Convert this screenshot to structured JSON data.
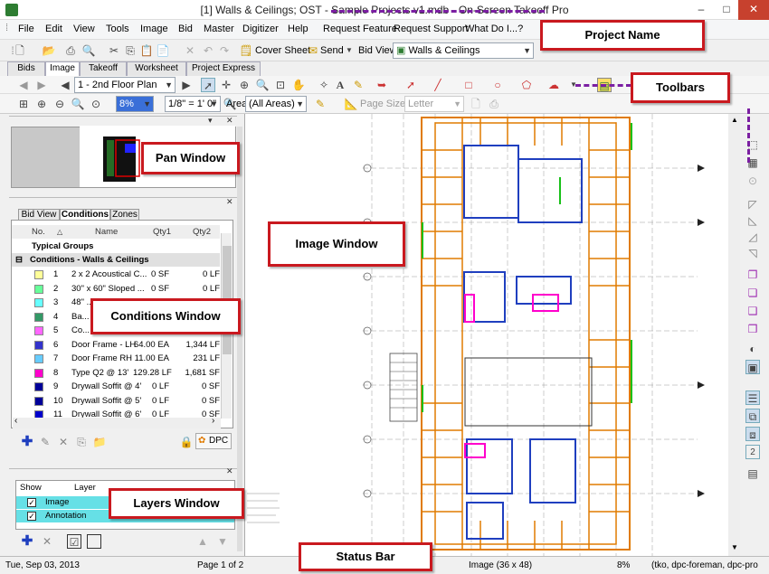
{
  "window": {
    "title": "[1] Walls & Ceilings; OST - Sample Projects v1.mdb - On-Screen Takeoff Pro",
    "minimize": "–",
    "maximize": "□",
    "close": "✕"
  },
  "menu": [
    "File",
    "Edit",
    "View",
    "Tools",
    "Image",
    "Bid",
    "Master",
    "Digitizer",
    "Help",
    "Request Feature",
    "Request Support",
    "What Do I...?"
  ],
  "toolbar": {
    "cover_sheet": "Cover Sheet",
    "send": "Send",
    "bid_view_label": "Bid View",
    "bid_view_value": "Walls & Ceilings"
  },
  "tabs": [
    "Bids",
    "Image",
    "Takeoff",
    "Worksheet",
    "Project Express"
  ],
  "image_toolbar": {
    "page": "1 - 2nd Floor Plan"
  },
  "zoom_toolbar": {
    "zoom": "8%",
    "scale": "1/8\" = 1' 0\"",
    "area_label": "Area",
    "area_value": "(All Areas)",
    "page_size_label": "Page Size",
    "page_size_value": "Letter"
  },
  "conditions": {
    "tabs": [
      "Bid View",
      "Conditions",
      "Zones"
    ],
    "headers": [
      "No.",
      "Name",
      "Qty1",
      "Qty2"
    ],
    "group": "Typical Groups",
    "subgroup": "Conditions - Walls & Ceilings",
    "rows": [
      {
        "no": "1",
        "name": "2 x 2 Acoustical C...",
        "qty1": "0 SF",
        "qty2": "0 LF",
        "color": "#ffff99"
      },
      {
        "no": "2",
        "name": "30\" x 60\" Sloped ...",
        "qty1": "0 SF",
        "qty2": "0 LF",
        "color": "#66ff99"
      },
      {
        "no": "3",
        "name": "48\" ...",
        "qty1": "",
        "qty2": "",
        "color": "#66ffff"
      },
      {
        "no": "4",
        "name": "Ba...",
        "qty1": "",
        "qty2": "",
        "color": "#339966"
      },
      {
        "no": "5",
        "name": "Co...",
        "qty1": "",
        "qty2": "",
        "color": "#ff66ff"
      },
      {
        "no": "6",
        "name": "Door Frame - LH",
        "qty1": "64.00 EA",
        "qty2": "1,344 LF",
        "color": "#3333cc"
      },
      {
        "no": "7",
        "name": "Door Frame RH",
        "qty1": "11.00 EA",
        "qty2": "231 LF",
        "color": "#66ccff"
      },
      {
        "no": "8",
        "name": "Type Q2 @ 13'",
        "qty1": "129.28 LF",
        "qty2": "1,681 SF",
        "color": "#ff00cc"
      },
      {
        "no": "9",
        "name": "Drywall Soffit @ 4'",
        "qty1": "0 LF",
        "qty2": "0 SF",
        "color": "#000099"
      },
      {
        "no": "10",
        "name": "Drywall Soffit @ 5'",
        "qty1": "0 LF",
        "qty2": "0 SF",
        "color": "#000099"
      },
      {
        "no": "11",
        "name": "Drywall Soffit @ 6'",
        "qty1": "0 LF",
        "qty2": "0 SF",
        "color": "#0000cc"
      }
    ],
    "dpc": "DPC"
  },
  "layers": {
    "headers": [
      "Show",
      "Layer"
    ],
    "rows": [
      {
        "name": "Image",
        "checked": "✓"
      },
      {
        "name": "Annotation",
        "checked": "✓"
      }
    ]
  },
  "status": {
    "date": "Tue, Sep 03, 2013",
    "page": "Page 1 of 2",
    "image": "Image (36 x 48)",
    "zoom": "8%",
    "users": "(tko, dpc-foreman, dpc-pro"
  },
  "callouts": {
    "project_name": "Project Name",
    "toolbars": "Toolbars",
    "pan": "Pan Window",
    "image": "Image Window",
    "conditions": "Conditions Window",
    "layers": "Layers Window",
    "status": "Status Bar"
  },
  "colors": {
    "callout_border": "#c9191f",
    "arrow": "#7b1fa2",
    "walls": "#e07b00",
    "accent": "#1f3fbf"
  }
}
